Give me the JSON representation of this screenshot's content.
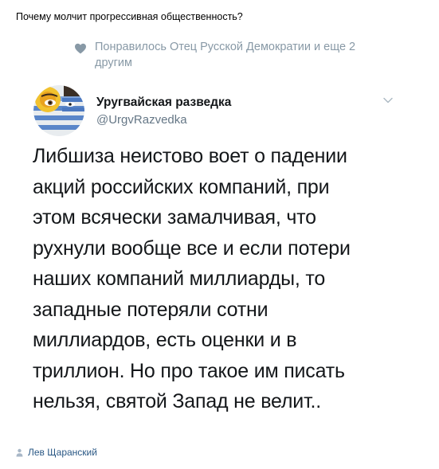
{
  "post": {
    "text": "Почему молчит прогрессивная общественность?"
  },
  "tweet": {
    "liked_by": "Понравилось Отец Русской Демократии и еще 2 другим",
    "author_name": "Уругвайская разведка",
    "author_handle": "@UrgvRazvedka",
    "body": "Либшиза неистово воет о падении\nакций российских компаний, при\nэтом всячески замалчивая, что\nрухнули вообще все и если потери\nнаших компаний миллиарды, то\nзападные потеряли сотни\nмиллиардов, есть оценки и в\nтриллион. Но про такое им писать\nнельзя, святой Запад не велит.."
  },
  "footer": {
    "author": "Лев Щаранский"
  },
  "icons": {
    "heart": "heart-icon",
    "chevron": "chevron-down-icon",
    "user": "user-icon"
  },
  "colors": {
    "muted_text": "#8899a6",
    "link_blue": "#2a5885",
    "tweet_text": "#14171a"
  }
}
